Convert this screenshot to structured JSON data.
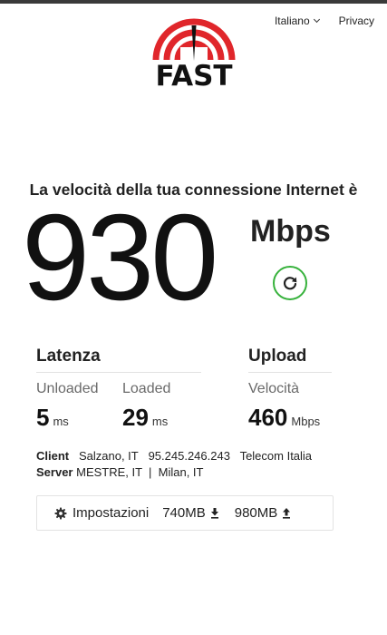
{
  "header": {
    "language": "Italiano",
    "privacy": "Privacy"
  },
  "logo": {
    "text": "FAST",
    "color": "#e0262b"
  },
  "headline": "La velocità della tua connessione Internet è",
  "speed": {
    "value": "930",
    "unit": "Mbps",
    "refresh_icon": "refresh-icon",
    "accent": "#37b23c"
  },
  "latency": {
    "title": "Latenza",
    "unloaded_label": "Unloaded",
    "unloaded_value": "5",
    "unloaded_unit": "ms",
    "loaded_label": "Loaded",
    "loaded_value": "29",
    "loaded_unit": "ms"
  },
  "upload": {
    "title": "Upload",
    "speed_label": "Velocità",
    "speed_value": "460",
    "speed_unit": "Mbps"
  },
  "client": {
    "label": "Client",
    "location": "Salzano, IT",
    "ip": "95.245.246.243",
    "isp": "Telecom Italia"
  },
  "server": {
    "label": "Server",
    "locations": "MESTRE, IT  |  Milan, IT"
  },
  "settings": {
    "label": "Impostazioni",
    "download_amount": "740MB",
    "upload_amount": "980MB"
  }
}
